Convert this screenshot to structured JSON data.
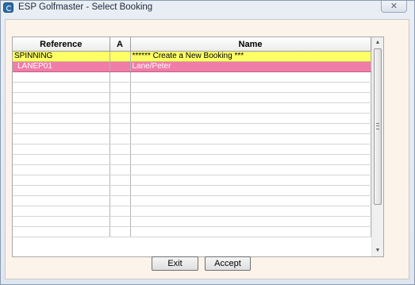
{
  "window": {
    "title": "ESP Golfmaster - Select Booking",
    "close_label": "✕"
  },
  "grid": {
    "columns": [
      "Reference",
      "A",
      "Name"
    ],
    "rows": [
      {
        "reference": "SPINNING",
        "a": "",
        "name": "****** Create a New Booking ***",
        "highlight": "yellow"
      },
      {
        "reference": "LANEP01",
        "a": "",
        "name": "Lane/Peter",
        "highlight": "pink"
      }
    ],
    "empty_rows": 16,
    "scroll": {
      "up_icon": "▲",
      "down_icon": "▼"
    }
  },
  "buttons": {
    "exit": "Exit",
    "accept": "Accept"
  },
  "colors": {
    "selected_row": "#f07ca8",
    "new_booking_row": "#ffff66",
    "client_background": "#fcf3ea"
  },
  "icons": {
    "app": "app-icon",
    "close": "close-icon"
  }
}
